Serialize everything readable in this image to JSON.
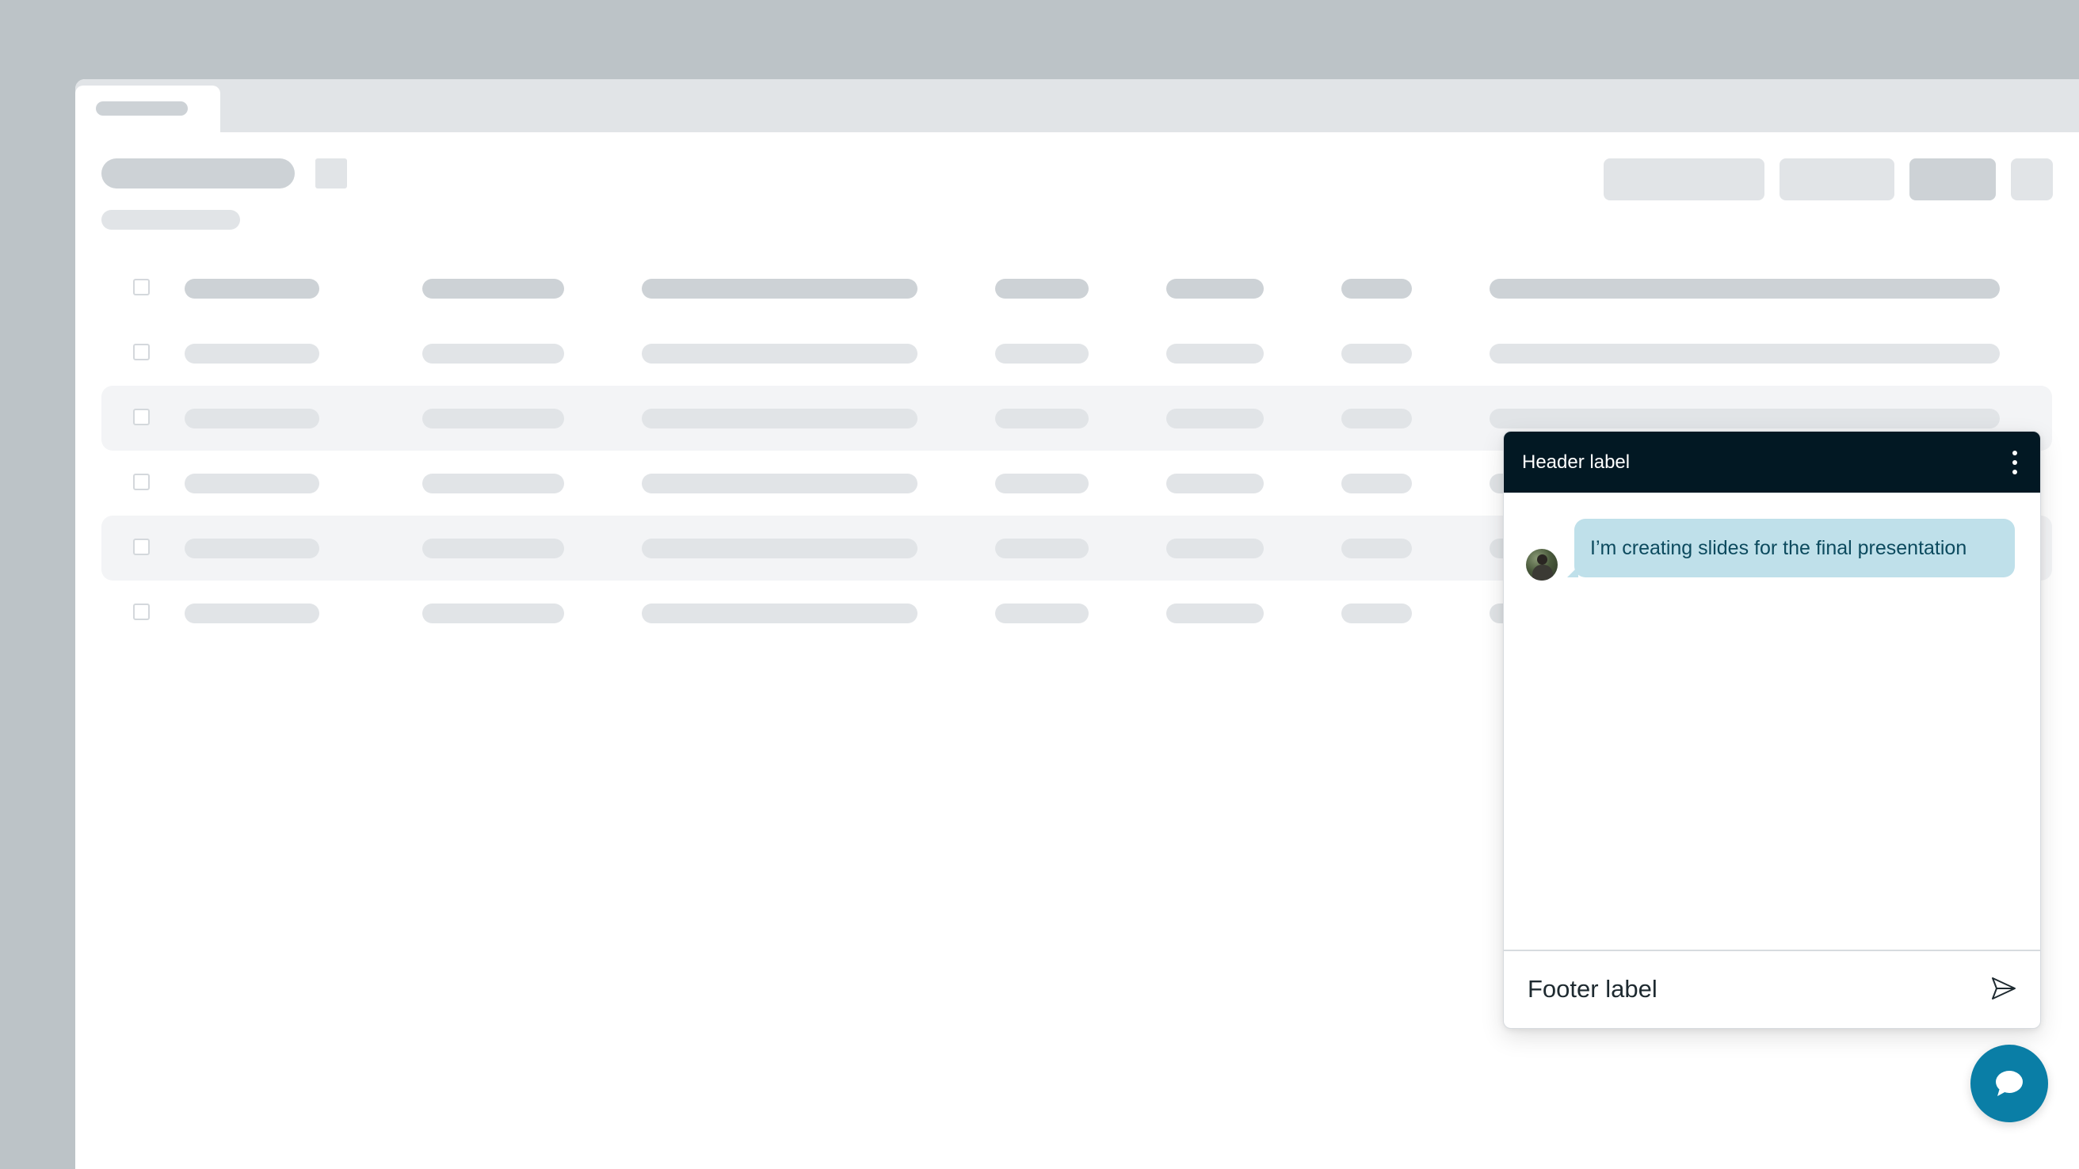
{
  "chat": {
    "header_label": "Header label",
    "messages": [
      {
        "text": "I’m creating slides for the final presentation"
      }
    ],
    "footer_placeholder": "Footer label"
  },
  "icons": {
    "menu": "kebab-menu-icon",
    "send": "send-icon",
    "fab": "chat-bubble-icon",
    "avatar": "user-avatar"
  },
  "colors": {
    "header_bg": "#021823",
    "bubble_bg": "#bfe0ea",
    "bubble_text": "#0c4a5e",
    "fab_bg": "#0a7ea6",
    "skeleton_dark": "#cdd2d6",
    "skeleton_light": "#e1e4e7",
    "row_stripe": "#f3f4f6",
    "backdrop": "#bcc3c7"
  },
  "table": {
    "row_count": 6,
    "striped_rows": [
      2,
      4
    ]
  }
}
